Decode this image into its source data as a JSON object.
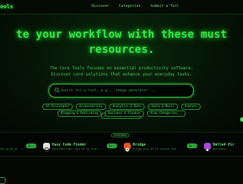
{
  "brand": "ools",
  "nav": [
    "Discover",
    "Categories",
    "Submit a Tool"
  ],
  "hero": {
    "line1": "te your workflow with these must",
    "line2": "resources."
  },
  "description": {
    "line1": "The Core Tools focuses on essential productivity software.",
    "line2": "Discover core solutions that enhance your everyday tasks."
  },
  "search": {
    "placeholder": "Search for a tool, e.g., 'image generator'..."
  },
  "categories_row1": [
    "AI Assistants",
    "Accessibility",
    "Analytics & Data",
    "Audio & Music",
    "Avatars",
    "Blockchain & Crypto"
  ],
  "categories_row2": [
    "Blogging & Publishing",
    "Business & Finance",
    "View Categories..."
  ],
  "sponsored_label": "SPONSORED",
  "sponsors": [
    {
      "name": "",
      "tagline": "the price of ...",
      "go": "Go ↗",
      "color": "#2e7d32"
    },
    {
      "name": "Easy Code Finder",
      "tagline": "Easycodefinder uses AI to find...",
      "go": "Go ↗",
      "color": "#e0e0e0"
    },
    {
      "name": "Bridge",
      "tagline": "Bridge uses AI to connect hum...",
      "go": "Go ↗",
      "color": "#e5542a"
    },
    {
      "name": "Dalle4 Pic",
      "tagline": "Dalle4pic ...",
      "go": "",
      "color": "#a64ad8"
    }
  ]
}
